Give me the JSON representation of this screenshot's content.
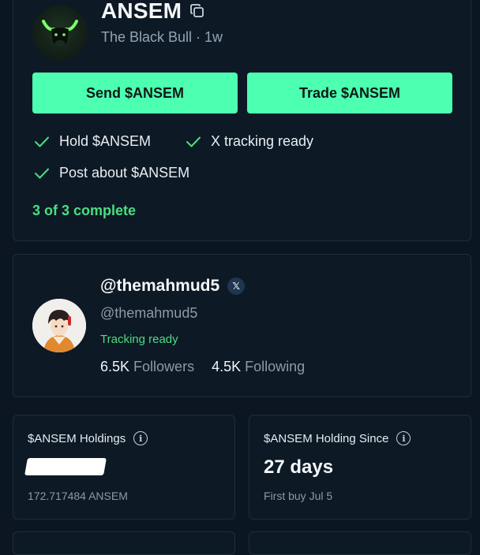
{
  "token": {
    "name": "ANSEM",
    "subtitle": "The Black Bull · 1w",
    "send_label": "Send $ANSEM",
    "trade_label": "Trade $ANSEM",
    "tasks": [
      "Hold $ANSEM",
      "X tracking ready",
      "Post about $ANSEM"
    ],
    "progress_text": "3 of 3 complete"
  },
  "profile": {
    "display_handle": "@themahmud5",
    "handle": "@themahmud5",
    "platform_badge": "𝕏",
    "tracking_status": "Tracking ready",
    "followers_count": "6.5K",
    "followers_label": "Followers",
    "following_count": "4.5K",
    "following_label": "Following"
  },
  "holdings": {
    "label": "$ANSEM Holdings",
    "value_redacted": true,
    "amount": "172.717484 ANSEM"
  },
  "since": {
    "label": "$ANSEM Holding Since",
    "value": "27 days",
    "first_buy": "First buy Jul 5"
  },
  "colors": {
    "background": "#0b1622",
    "accent": "#4dffb0",
    "success": "#4ade80"
  }
}
